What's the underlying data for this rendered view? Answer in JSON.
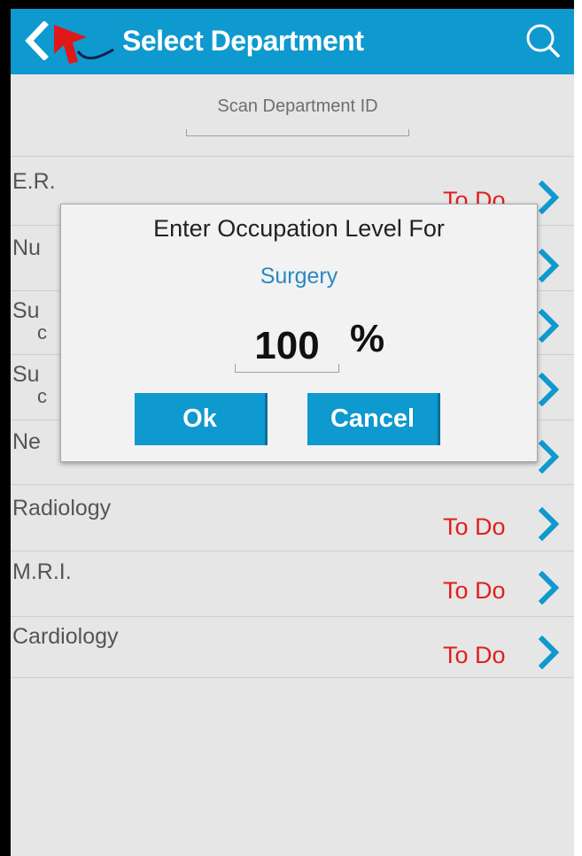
{
  "header": {
    "title": "Select Department",
    "back_icon": "chevron-left-icon",
    "search_icon": "search-icon"
  },
  "scan": {
    "placeholder": "Scan Department ID"
  },
  "departments": [
    {
      "label": "E.R.",
      "sub": "",
      "status": "To Do"
    },
    {
      "label": "Nu",
      "sub": "",
      "status": ""
    },
    {
      "label": "Su",
      "sub": "c",
      "status": ""
    },
    {
      "label": "Su",
      "sub": "c",
      "status": ""
    },
    {
      "label": "Ne",
      "sub": "",
      "status": ""
    },
    {
      "label": "Radiology",
      "sub": "",
      "status": "To Do"
    },
    {
      "label": "M.R.I.",
      "sub": "",
      "status": "To Do"
    },
    {
      "label": "Cardiology",
      "sub": "",
      "status": "To Do"
    }
  ],
  "dialog": {
    "title": "Enter Occupation Level For",
    "department": "Surgery",
    "level_value": "100",
    "level_unit": "%",
    "ok_label": "Ok",
    "cancel_label": "Cancel"
  },
  "colors": {
    "accent": "#0e99cf",
    "todo": "#e21e1e",
    "dept_link": "#2a88c0",
    "background": "#e6e6e6"
  }
}
